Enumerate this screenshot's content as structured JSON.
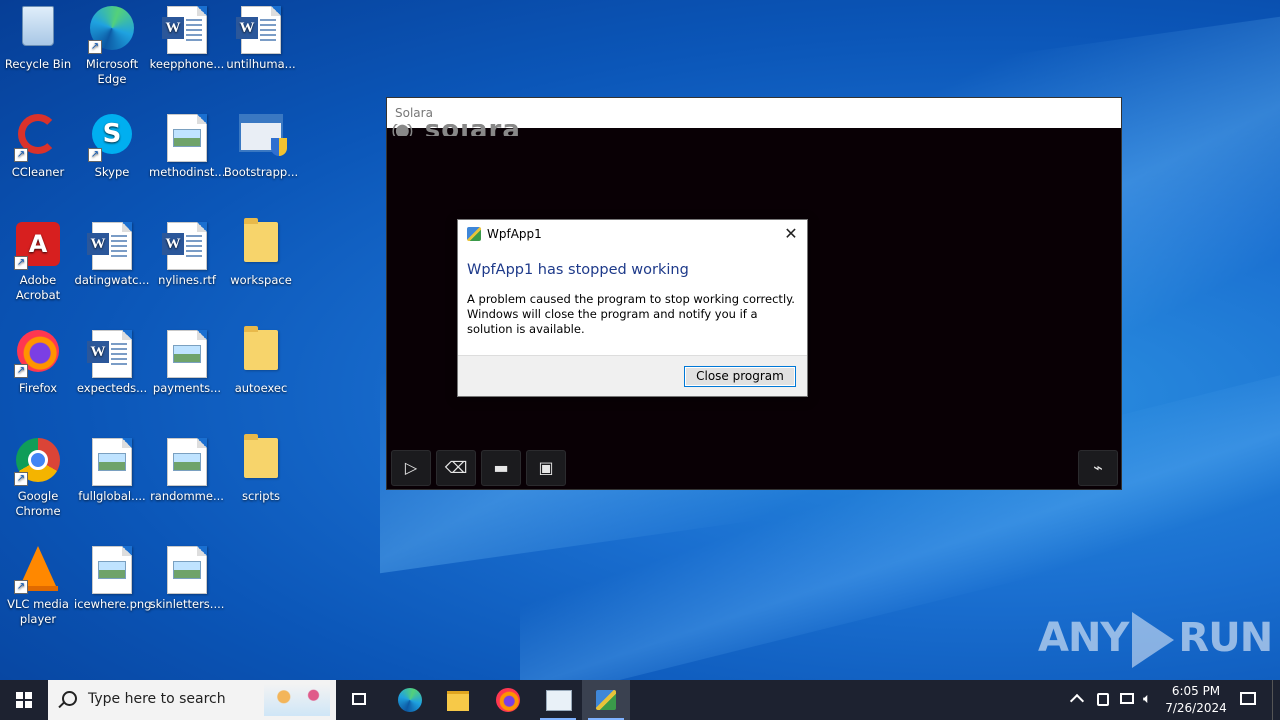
{
  "desktop": {
    "icons": [
      {
        "label": "Recycle Bin"
      },
      {
        "label": "Microsoft Edge"
      },
      {
        "label": "keepphone..."
      },
      {
        "label": "untilhuma..."
      },
      {
        "label": "CCleaner"
      },
      {
        "label": "Skype"
      },
      {
        "label": "methodinst..."
      },
      {
        "label": "Bootstrapp..."
      },
      {
        "label": "Adobe Acrobat"
      },
      {
        "label": "datingwatc..."
      },
      {
        "label": "nylines.rtf"
      },
      {
        "label": "workspace"
      },
      {
        "label": "Firefox"
      },
      {
        "label": "expecteds..."
      },
      {
        "label": "payments..."
      },
      {
        "label": "autoexec"
      },
      {
        "label": "Google Chrome"
      },
      {
        "label": "fullglobal...."
      },
      {
        "label": "randomme..."
      },
      {
        "label": "scripts"
      },
      {
        "label": "VLC media player"
      },
      {
        "label": "icewhere.png"
      },
      {
        "label": "skinletters...."
      }
    ]
  },
  "solara": {
    "title": "Solara",
    "toolbar": {
      "icons": [
        "play-icon",
        "eraser-icon",
        "folder-open-icon",
        "save-icon",
        "attach-icon"
      ]
    }
  },
  "dialog": {
    "title": "WpfApp1",
    "main_instruction": "WpfApp1 has stopped working",
    "content": "A problem caused the program to stop working correctly. Windows will close the program and notify you if a solution is available.",
    "close_button": "Close program"
  },
  "watermark": {
    "left": "ANY",
    "right": "RUN"
  },
  "taskbar": {
    "search_placeholder": "Type here to search",
    "clock": {
      "time": "6:05 PM",
      "date": "7/26/2024"
    },
    "accent": "#7fb2ff"
  }
}
